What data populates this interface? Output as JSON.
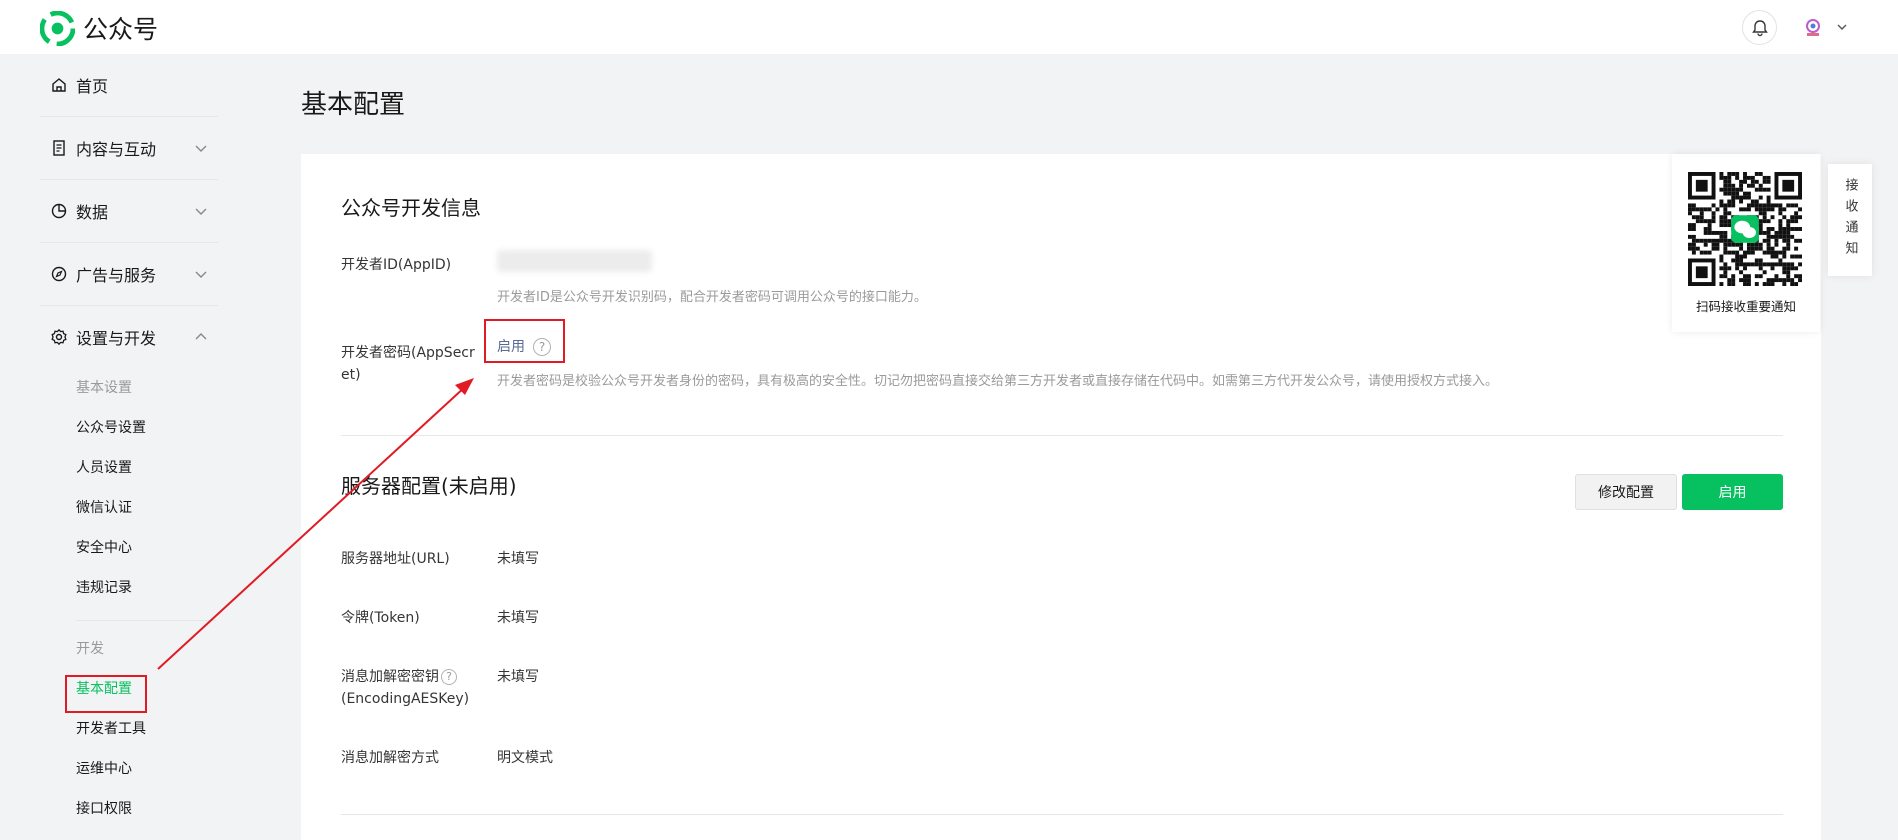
{
  "header": {
    "app_name": "公众号"
  },
  "sidebar": {
    "items": [
      {
        "label": "首页"
      },
      {
        "label": "内容与互动"
      },
      {
        "label": "数据"
      },
      {
        "label": "广告与服务"
      },
      {
        "label": "设置与开发"
      }
    ],
    "groups": [
      {
        "title": "基本设置",
        "items": [
          "公众号设置",
          "人员设置",
          "微信认证",
          "安全中心",
          "违规记录"
        ]
      },
      {
        "title": "开发",
        "items": [
          "基本配置",
          "开发者工具",
          "运维中心",
          "接口权限"
        ]
      }
    ],
    "active_item": "基本配置"
  },
  "page": {
    "title": "基本配置"
  },
  "dev_info": {
    "title": "公众号开发信息",
    "appid_label": "开发者ID(AppID)",
    "appid_hint": "开发者ID是公众号开发识别码，配合开发者密码可调用公众号的接口能力。",
    "secret_label": "开发者密码(AppSecret)",
    "secret_action": "启用",
    "secret_hint": "开发者密码是校验公众号开发者身份的密码，具有极高的安全性。切记勿把密码直接交给第三方开发者或直接存储在代码中。如需第三方代开发公众号，请使用授权方式接入。"
  },
  "server_config": {
    "title": "服务器配置(未启用)",
    "modify_button": "修改配置",
    "enable_button": "启用",
    "rows": [
      {
        "label": "服务器地址(URL)",
        "value": "未填写"
      },
      {
        "label": "令牌(Token)",
        "value": "未填写"
      },
      {
        "label": "消息加解密密钥",
        "label2": "(EncodingAESKey)",
        "value": "未填写"
      },
      {
        "label": "消息加解密方式",
        "value": "明文模式"
      }
    ]
  },
  "qr_panel": {
    "caption": "扫码接收重要通知",
    "tab_label": "接收通知"
  },
  "colors": {
    "accent": "#07c160",
    "link": "#576b95",
    "annotation": "#e01b24"
  },
  "icons": [
    "logo-icon",
    "bell-icon",
    "avatar-icon",
    "home-icon",
    "document-icon",
    "pie-chart-icon",
    "compass-icon",
    "gear-icon",
    "chevron-down-icon",
    "chevron-up-icon",
    "question-icon",
    "qr-code-icon"
  ]
}
